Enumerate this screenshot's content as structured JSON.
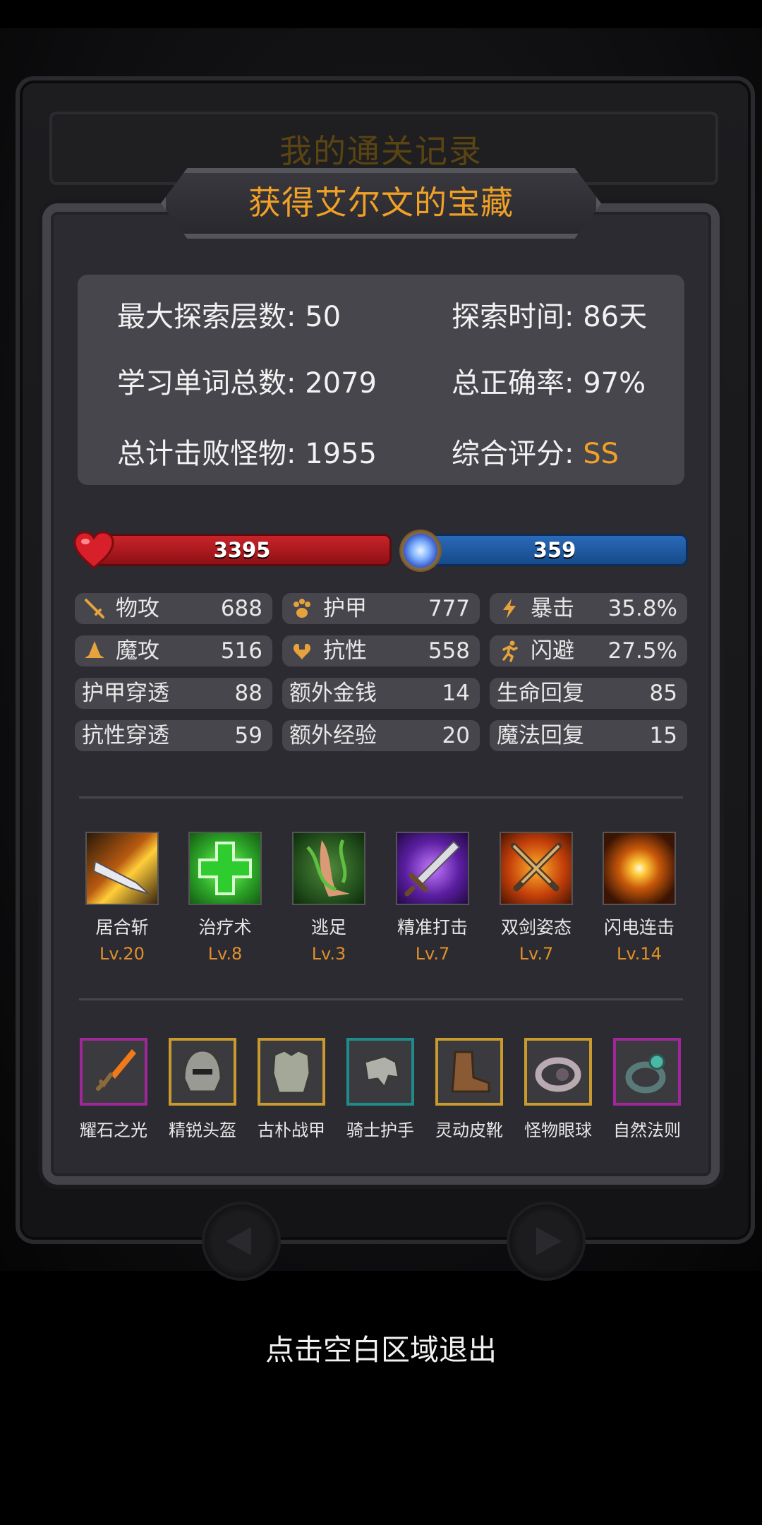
{
  "header": {
    "old_title": "我的通关记录",
    "title": "获得艾尔文的宝藏"
  },
  "summary": {
    "max_floor_label": "最大探索层数: 50",
    "explore_time_label": "探索时间: 86天",
    "words_label": "学习单词总数: 2079",
    "accuracy_label": "总正确率: 97%",
    "monsters_label": "总计击败怪物: 1955",
    "rating_label": "综合评分: ",
    "rating_value": "SS"
  },
  "bars": {
    "hp": "3395",
    "mp": "359"
  },
  "stats": {
    "atk": {
      "label": "物攻",
      "value": "688"
    },
    "armor": {
      "label": "护甲",
      "value": "777"
    },
    "crit": {
      "label": "暴击",
      "value": "35.8%"
    },
    "matk": {
      "label": "魔攻",
      "value": "516"
    },
    "resist": {
      "label": "抗性",
      "value": "558"
    },
    "dodge": {
      "label": "闪避",
      "value": "27.5%"
    },
    "armor_pen": {
      "label": "护甲穿透",
      "value": "88"
    },
    "extra_gold": {
      "label": "额外金钱",
      "value": "14"
    },
    "hp_regen": {
      "label": "生命回复",
      "value": "85"
    },
    "resist_pen": {
      "label": "抗性穿透",
      "value": "59"
    },
    "extra_exp": {
      "label": "额外经验",
      "value": "20"
    },
    "mp_regen": {
      "label": "魔法回复",
      "value": "15"
    }
  },
  "skills": [
    {
      "name": "居合斩",
      "level": "Lv.20"
    },
    {
      "name": "治疗术",
      "level": "Lv.8"
    },
    {
      "name": "逃足",
      "level": "Lv.3"
    },
    {
      "name": "精准打击",
      "level": "Lv.7"
    },
    {
      "name": "双剑姿态",
      "level": "Lv.7"
    },
    {
      "name": "闪电连击",
      "level": "Lv.14"
    }
  ],
  "items": [
    {
      "name": "耀石之光",
      "border": "#a0279a"
    },
    {
      "name": "精锐头盔",
      "border": "#c99a2e"
    },
    {
      "name": "古朴战甲",
      "border": "#c99a2e"
    },
    {
      "name": "骑士护手",
      "border": "#1f8c8c"
    },
    {
      "name": "灵动皮靴",
      "border": "#c99a2e"
    },
    {
      "name": "怪物眼球",
      "border": "#c99a2e"
    },
    {
      "name": "自然法则",
      "border": "#a0279a"
    }
  ],
  "footer": {
    "exit_hint": "点击空白区域退出"
  },
  "colors": {
    "accent": "#f0a026",
    "hp": "#c8242a",
    "mp": "#2a6ab8"
  }
}
